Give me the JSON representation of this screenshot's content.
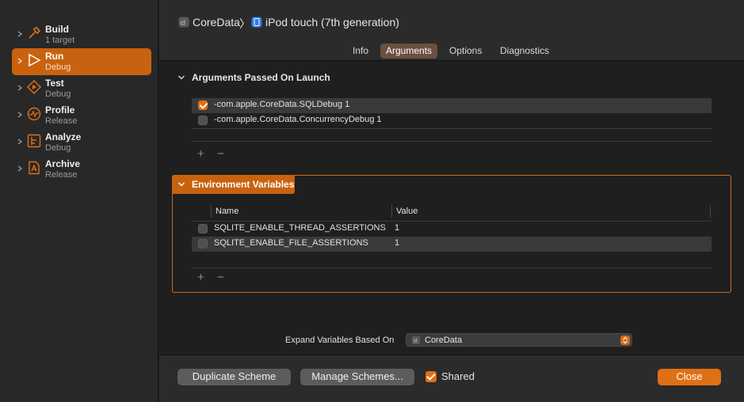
{
  "sidebar": {
    "items": [
      {
        "title": "Build",
        "subtitle": "1 target",
        "icon": "hammer-icon"
      },
      {
        "title": "Run",
        "subtitle": "Debug",
        "icon": "play-icon"
      },
      {
        "title": "Test",
        "subtitle": "Debug",
        "icon": "test-diamond-icon"
      },
      {
        "title": "Profile",
        "subtitle": "Release",
        "icon": "gauge-icon"
      },
      {
        "title": "Analyze",
        "subtitle": "Debug",
        "icon": "analyze-icon"
      },
      {
        "title": "Archive",
        "subtitle": "Release",
        "icon": "archive-icon"
      }
    ],
    "selected_index": 1
  },
  "header": {
    "project": "CoreData",
    "separator": "〉",
    "device": "iPod touch (7th generation)"
  },
  "tabs": [
    {
      "label": "Info",
      "active": false
    },
    {
      "label": "Arguments",
      "active": true
    },
    {
      "label": "Options",
      "active": false
    },
    {
      "label": "Diagnostics",
      "active": false
    }
  ],
  "arguments": {
    "title": "Arguments Passed On Launch",
    "rows": [
      {
        "value": "-com.apple.CoreData.SQLDebug 1",
        "checked": true
      },
      {
        "value": "-com.apple.CoreData.ConcurrencyDebug 1",
        "checked": false
      }
    ],
    "add_label": "+",
    "remove_label": "−"
  },
  "environment": {
    "title": "Environment Variables",
    "columns": {
      "name": "Name",
      "value": "Value"
    },
    "rows": [
      {
        "name": "SQLITE_ENABLE_THREAD_ASSERTIONS",
        "value": "1",
        "checked": false
      },
      {
        "name": "SQLITE_ENABLE_FILE_ASSERTIONS",
        "value": "1",
        "checked": false
      }
    ],
    "add_label": "+",
    "remove_label": "−"
  },
  "expand": {
    "label": "Expand Variables Based On",
    "selected": "CoreData"
  },
  "footer": {
    "duplicate": "Duplicate Scheme",
    "manage": "Manage Schemes...",
    "shared_label": "Shared",
    "shared_checked": true,
    "close": "Close"
  },
  "colors": {
    "accent": "#e07015",
    "selection": "#c9620f",
    "background": "#1f1f1f"
  }
}
